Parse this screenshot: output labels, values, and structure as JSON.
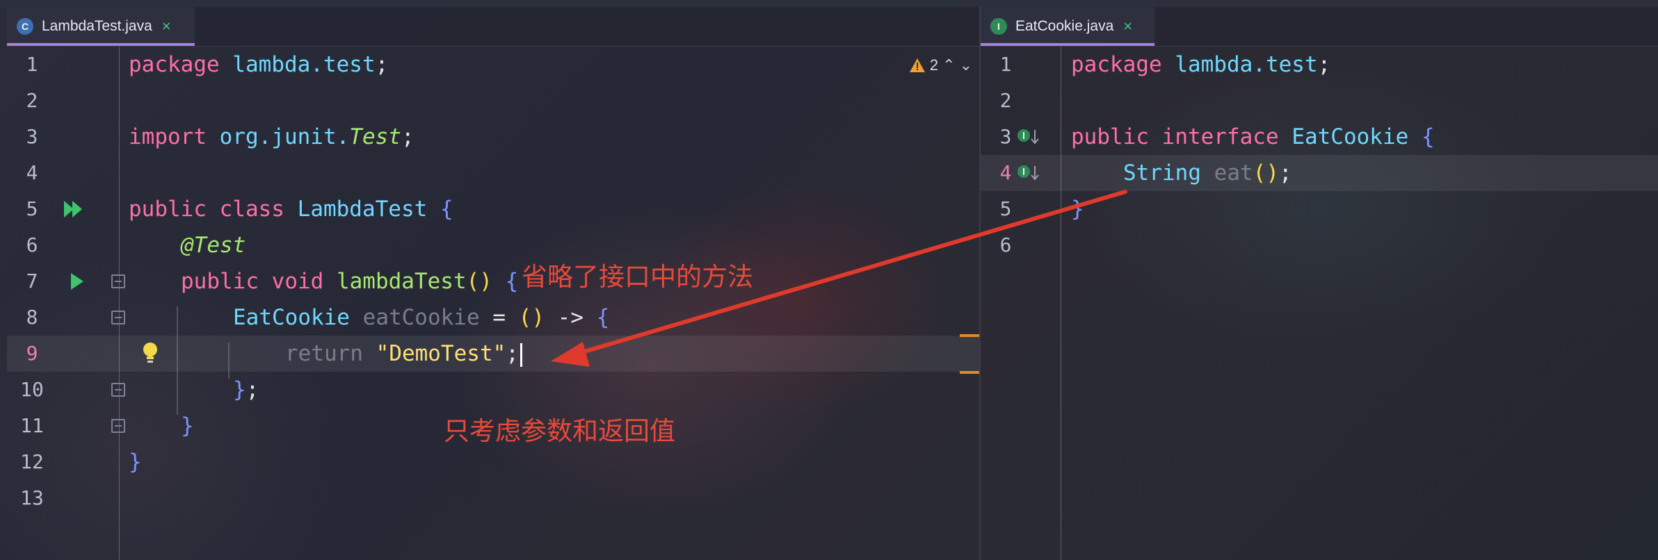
{
  "left_tab": {
    "label": "LambdaTest.java",
    "icon": "c-class-icon",
    "close": "×"
  },
  "right_tab": {
    "label": "EatCookie.java",
    "icon": "i-interface-icon",
    "close": "×"
  },
  "left_editor": {
    "warning_count": "2",
    "line_numbers": [
      "1",
      "2",
      "3",
      "4",
      "5",
      "6",
      "7",
      "8",
      "9",
      "10",
      "11",
      "12",
      "13"
    ],
    "lines": {
      "l1": {
        "kw": "package",
        "pkg": "lambda.test",
        "semi": ";"
      },
      "l3": {
        "kw": "import",
        "pkg": "org.junit.",
        "cls": "Test",
        "semi": ";"
      },
      "l5": {
        "kw1": "public",
        "kw2": "class",
        "name": "LambdaTest",
        "brace": "{"
      },
      "l6": {
        "ann": "@Test"
      },
      "l7": {
        "kw1": "public",
        "kw2": "void",
        "fn": "lambdaTest",
        "parens": "()",
        "brace": "{"
      },
      "l8": {
        "cls": "EatCookie",
        "var": "eatCookie",
        "eq": "=",
        "parens": "()",
        "arrow": "->",
        "brace": "{"
      },
      "l9": {
        "kw": "return",
        "str": "\"DemoTest\"",
        "semi": ";"
      },
      "l10": {
        "brace": "}",
        "semi": ";"
      },
      "l11": {
        "brace": "}"
      },
      "l12": {
        "brace": "}"
      }
    }
  },
  "right_editor": {
    "line_numbers": [
      "1",
      "2",
      "3",
      "4",
      "5",
      "6"
    ],
    "lines": {
      "l1": {
        "kw": "package",
        "pkg": "lambda.test",
        "semi": ";"
      },
      "l3": {
        "kw1": "public",
        "kw2": "interface",
        "name": "EatCookie",
        "brace": "{"
      },
      "l4": {
        "cls": "String",
        "fn": "eat",
        "parens": "()",
        "semi": ";"
      },
      "l5": {
        "brace": "}"
      }
    }
  },
  "annotations": {
    "omit_method": "省略了接口中的方法",
    "params_return": "只考虑参数和返回值"
  },
  "colors": {
    "annotation_red": "#e84a3a",
    "active_tab_underline": "#a87ee0",
    "keyword": "#ff6fa6",
    "class": "#70d8ff",
    "function": "#a8e86c",
    "string": "#ffdf7a"
  }
}
